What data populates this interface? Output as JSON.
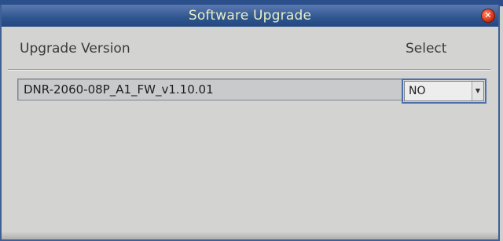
{
  "dialog": {
    "title": "Software Upgrade",
    "close_icon": "close-icon"
  },
  "table": {
    "headers": {
      "version": "Upgrade Version",
      "select": "Select"
    },
    "rows": [
      {
        "version": "DNR-2060-08P_A1_FW_v1.10.01",
        "select": "NO"
      }
    ]
  },
  "colors": {
    "titlebar": "#2f558f",
    "title_text": "#e9f0c4",
    "dialog_bg": "#d3d4d2",
    "close_button": "#d63515"
  }
}
